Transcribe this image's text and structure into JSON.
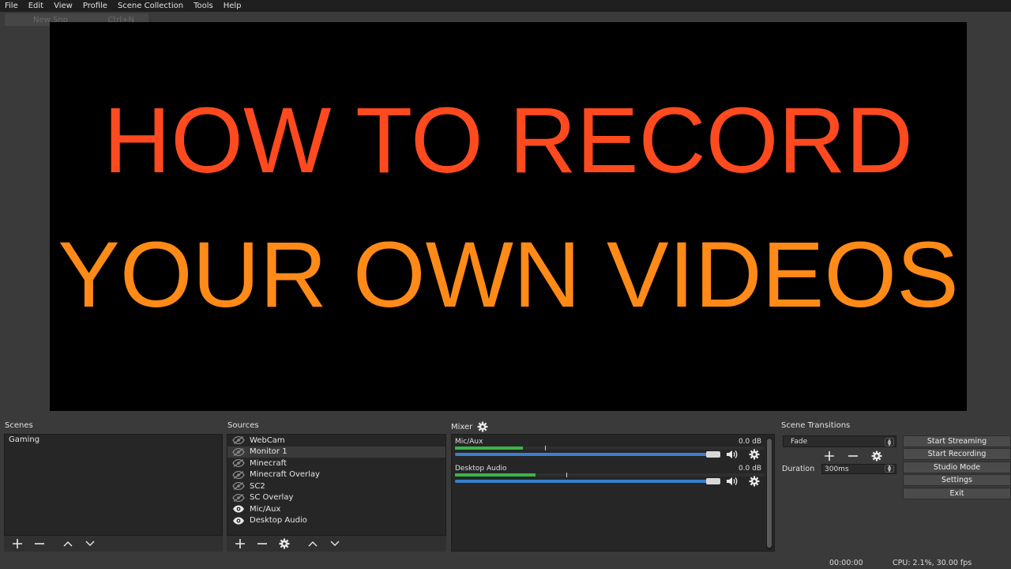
{
  "menu": {
    "items": [
      "File",
      "Edit",
      "View",
      "Profile",
      "Scene Collection",
      "Tools",
      "Help"
    ],
    "ghost_left": "New Snp",
    "ghost_right": "Ctrl+N"
  },
  "preview": {
    "line1": "HOW TO RECORD",
    "line2": "YOUR OWN VIDEOS",
    "line1_color": "#ff4a1f",
    "line2_color": "#ff8a18"
  },
  "scenes": {
    "title": "Scenes",
    "items": [
      "Gaming"
    ]
  },
  "sources": {
    "title": "Sources",
    "items": [
      {
        "label": "WebCam",
        "visible": false
      },
      {
        "label": "Monitor 1",
        "visible": false
      },
      {
        "label": "Minecraft",
        "visible": false
      },
      {
        "label": "Minecraft Overlay",
        "visible": false
      },
      {
        "label": "SC2",
        "visible": false
      },
      {
        "label": "SC Overlay",
        "visible": false
      },
      {
        "label": "Mic/Aux",
        "visible": true
      },
      {
        "label": "Desktop Audio",
        "visible": true
      }
    ]
  },
  "mixer": {
    "title": "Mixer",
    "channels": [
      {
        "name": "Mic/Aux",
        "db": "0.0 dB",
        "level": 0.22,
        "peak": 0.29,
        "volume": 1.0
      },
      {
        "name": "Desktop Audio",
        "db": "0.0 dB",
        "level": 0.26,
        "peak": 0.36,
        "volume": 1.0
      }
    ]
  },
  "transitions": {
    "title": "Scene Transitions",
    "selected": "Fade",
    "duration_label": "Duration",
    "duration_value": "300ms"
  },
  "controls": {
    "start_streaming": "Start Streaming",
    "start_recording": "Start Recording",
    "studio_mode": "Studio Mode",
    "settings": "Settings",
    "exit": "Exit"
  },
  "status": {
    "time": "00:00:00",
    "cpu": "CPU: 2.1%, 30.00 fps"
  },
  "colors": {
    "meter_green": "#39b54a",
    "volume_blue": "#3a7fcf"
  }
}
